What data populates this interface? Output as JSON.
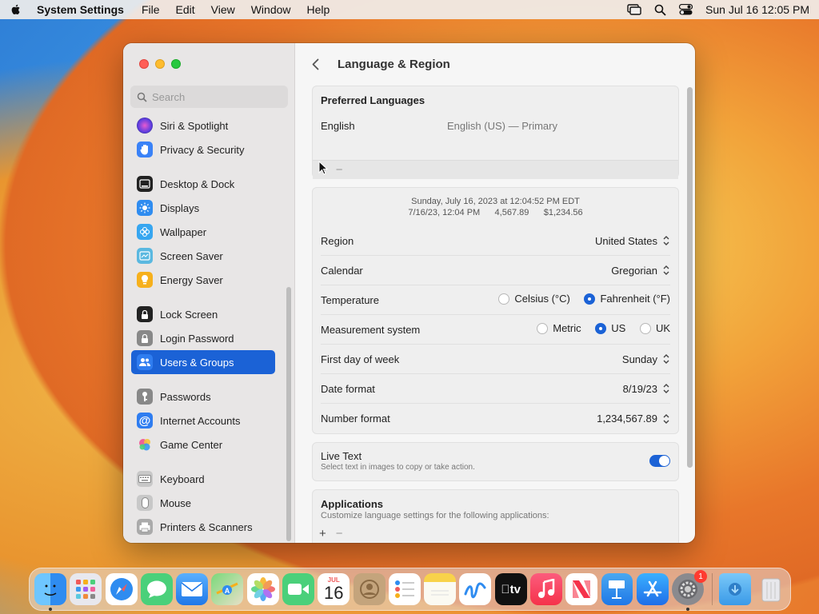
{
  "menubar": {
    "app": "System Settings",
    "menus": [
      "File",
      "Edit",
      "View",
      "Window",
      "Help"
    ],
    "datetime": "Sun Jul 16  12:05 PM"
  },
  "sidebar": {
    "search_placeholder": "Search",
    "items": [
      {
        "label": "Siri & Spotlight",
        "icon": "siri-icon",
        "color": "#8e44ad"
      },
      {
        "label": "Privacy & Security",
        "icon": "hand-icon",
        "color": "#3a82f7"
      },
      {
        "label": "Desktop & Dock",
        "icon": "dock-icon",
        "color": "#222222"
      },
      {
        "label": "Displays",
        "icon": "sun-icon",
        "color": "#2f8cf0"
      },
      {
        "label": "Wallpaper",
        "icon": "flower-icon",
        "color": "#37a6f0"
      },
      {
        "label": "Screen Saver",
        "icon": "screensaver-icon",
        "color": "#5ab8e0"
      },
      {
        "label": "Energy Saver",
        "icon": "bulb-icon",
        "color": "#f6b01c"
      },
      {
        "label": "Lock Screen",
        "icon": "lock-icon",
        "color": "#222222"
      },
      {
        "label": "Login Password",
        "icon": "lock-icon",
        "color": "#888888"
      },
      {
        "label": "Users & Groups",
        "icon": "users-icon",
        "color": "#2f7df0",
        "selected": true
      },
      {
        "label": "Passwords",
        "icon": "key-icon",
        "color": "#888888"
      },
      {
        "label": "Internet Accounts",
        "icon": "at-icon",
        "color": "#2f7df0"
      },
      {
        "label": "Game Center",
        "icon": "gamecenter-icon",
        "color": "#e04a8a"
      },
      {
        "label": "Keyboard",
        "icon": "keyboard-icon",
        "color": "#999999"
      },
      {
        "label": "Mouse",
        "icon": "mouse-icon",
        "color": "#999999"
      },
      {
        "label": "Printers & Scanners",
        "icon": "printer-icon",
        "color": "#888888"
      }
    ]
  },
  "content": {
    "title": "Language & Region",
    "preferred": {
      "title": "Preferred Languages",
      "language": "English",
      "language_detail": "English (US) — Primary",
      "add": "+",
      "remove": "−"
    },
    "preview": {
      "line1": "Sunday, July 16, 2023 at 12:04:52 PM EDT",
      "line2": "7/16/23, 12:04 PM      4,567.89      $1,234.56"
    },
    "region": {
      "label": "Region",
      "value": "United States"
    },
    "calendar": {
      "label": "Calendar",
      "value": "Gregorian"
    },
    "temperature": {
      "label": "Temperature",
      "opt1": "Celsius (°C)",
      "opt2": "Fahrenheit (°F)",
      "selected": "Fahrenheit (°F)"
    },
    "measurement": {
      "label": "Measurement system",
      "opt1": "Metric",
      "opt2": "US",
      "opt3": "UK",
      "selected": "US"
    },
    "first_day": {
      "label": "First day of week",
      "value": "Sunday"
    },
    "date_format": {
      "label": "Date format",
      "value": "8/19/23"
    },
    "number_format": {
      "label": "Number format",
      "value": "1,234,567.89"
    },
    "live_text": {
      "label": "Live Text",
      "desc": "Select text in images to copy or take action.",
      "enabled": true
    },
    "applications": {
      "title": "Applications",
      "desc": "Customize language settings for the following applications:",
      "add": "+",
      "remove": "−"
    }
  },
  "dock": {
    "items": [
      "Finder",
      "Launchpad",
      "Safari",
      "Messages",
      "Mail",
      "Maps",
      "Photos",
      "FaceTime",
      "Calendar",
      "Contacts",
      "Reminders",
      "Notes",
      "Freeform",
      "TV",
      "Music",
      "News",
      "Keynote",
      "App Store",
      "System Settings"
    ],
    "calendar_month": "JUL",
    "calendar_day": "16",
    "tv_label": "tv",
    "settings_badge": "1"
  }
}
